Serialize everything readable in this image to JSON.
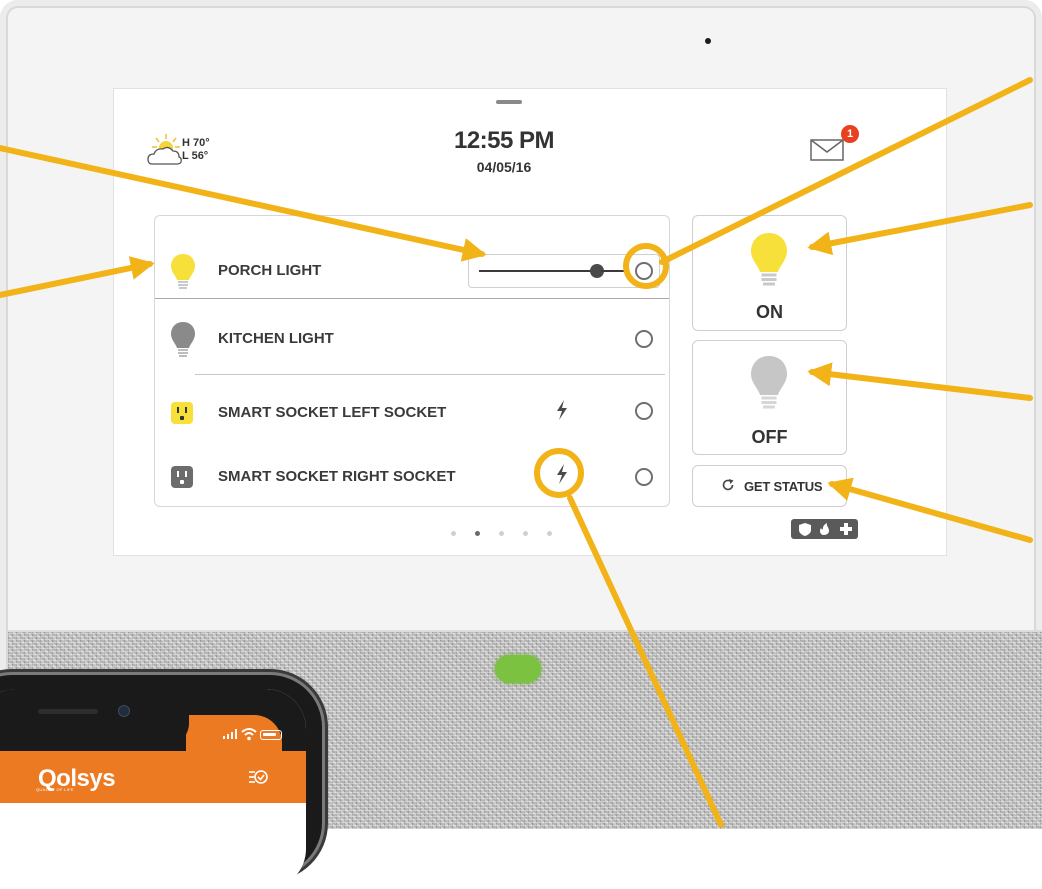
{
  "header": {
    "weather": {
      "high": "H 70°",
      "low": "L 56°",
      "icon": "partly-cloudy-icon"
    },
    "time": "12:55 PM",
    "date": "04/05/16",
    "messages": {
      "icon": "mail-icon",
      "badge": "1"
    }
  },
  "devices": [
    {
      "name": "PORCH LIGHT",
      "icon": "light-bulb-on-icon",
      "state": "on",
      "dimmer_level": 0.84
    },
    {
      "name": "KITCHEN LIGHT",
      "icon": "light-bulb-off-icon",
      "state": "off"
    },
    {
      "name": "SMART SOCKET LEFT SOCKET",
      "icon": "smart-socket-on-icon",
      "state": "on",
      "power_icon": "lightning-bolt-icon"
    },
    {
      "name": "SMART SOCKET RIGHT SOCKET",
      "icon": "smart-socket-off-icon",
      "state": "off",
      "power_icon": "lightning-bolt-icon"
    }
  ],
  "actions": {
    "on_label": "ON",
    "off_label": "OFF",
    "get_status_label": "GET STATUS"
  },
  "pagination": {
    "pages": 5,
    "active": 2
  },
  "phone": {
    "brand": "Qolsys",
    "tagline": "QUALITY OF LIFE"
  },
  "colors": {
    "bulb_on": "#f7e03a",
    "bulb_off": "#bdbdbd",
    "accent_arrow": "#f2b318",
    "brand_orange": "#ec7a22"
  }
}
